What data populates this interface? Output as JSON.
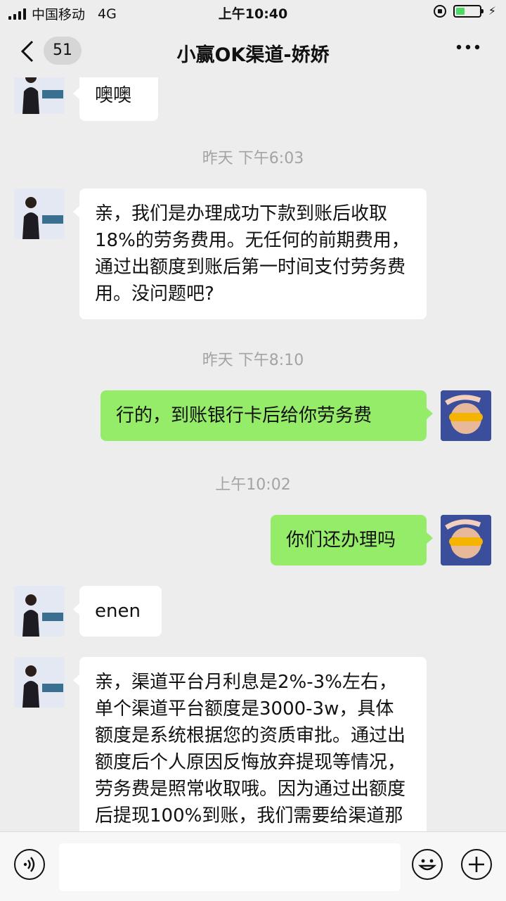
{
  "status_bar": {
    "carrier": "中国移动",
    "network": "4G",
    "time": "上午10:40"
  },
  "header": {
    "back_icon": "chevron-left-icon",
    "unread_count": "51",
    "title": "小赢OK渠道-娇娇",
    "more_icon": "ellipsis-icon"
  },
  "messages": [
    {
      "type": "incoming",
      "text": "噢噢"
    },
    {
      "type": "timestamp",
      "text": "昨天 下午6:03"
    },
    {
      "type": "incoming",
      "text": "亲，我们是办理成功下款到账后收取18%的劳务费用。无任何的前期费用，通过出额度到账后第一时间支付劳务费用。没问题吧?"
    },
    {
      "type": "timestamp",
      "text": "昨天 下午8:10"
    },
    {
      "type": "outgoing",
      "text": "行的，到账银行卡后给你劳务费"
    },
    {
      "type": "timestamp",
      "text": "上午10:02"
    },
    {
      "type": "outgoing",
      "text": "你们还办理吗"
    },
    {
      "type": "incoming",
      "text": "enen"
    },
    {
      "type": "incoming",
      "text": "亲，渠道平台月利息是2%-3%左右，单个渠道平台额度是3000-3w，具体额度是系统根据您的资质审批。通过出额度后个人原因反悔放弃提现等情况，劳务费是照常收取哦。因为通过出额度后提现100%到账，我们需要给渠道那边"
    }
  ],
  "input_bar": {
    "voice_icon": "voice-icon",
    "emoji_icon": "emoji-icon",
    "plus_icon": "plus-icon"
  },
  "colors": {
    "background": "#ededed",
    "outgoing_bubble": "#95ec69",
    "incoming_bubble": "#ffffff"
  }
}
